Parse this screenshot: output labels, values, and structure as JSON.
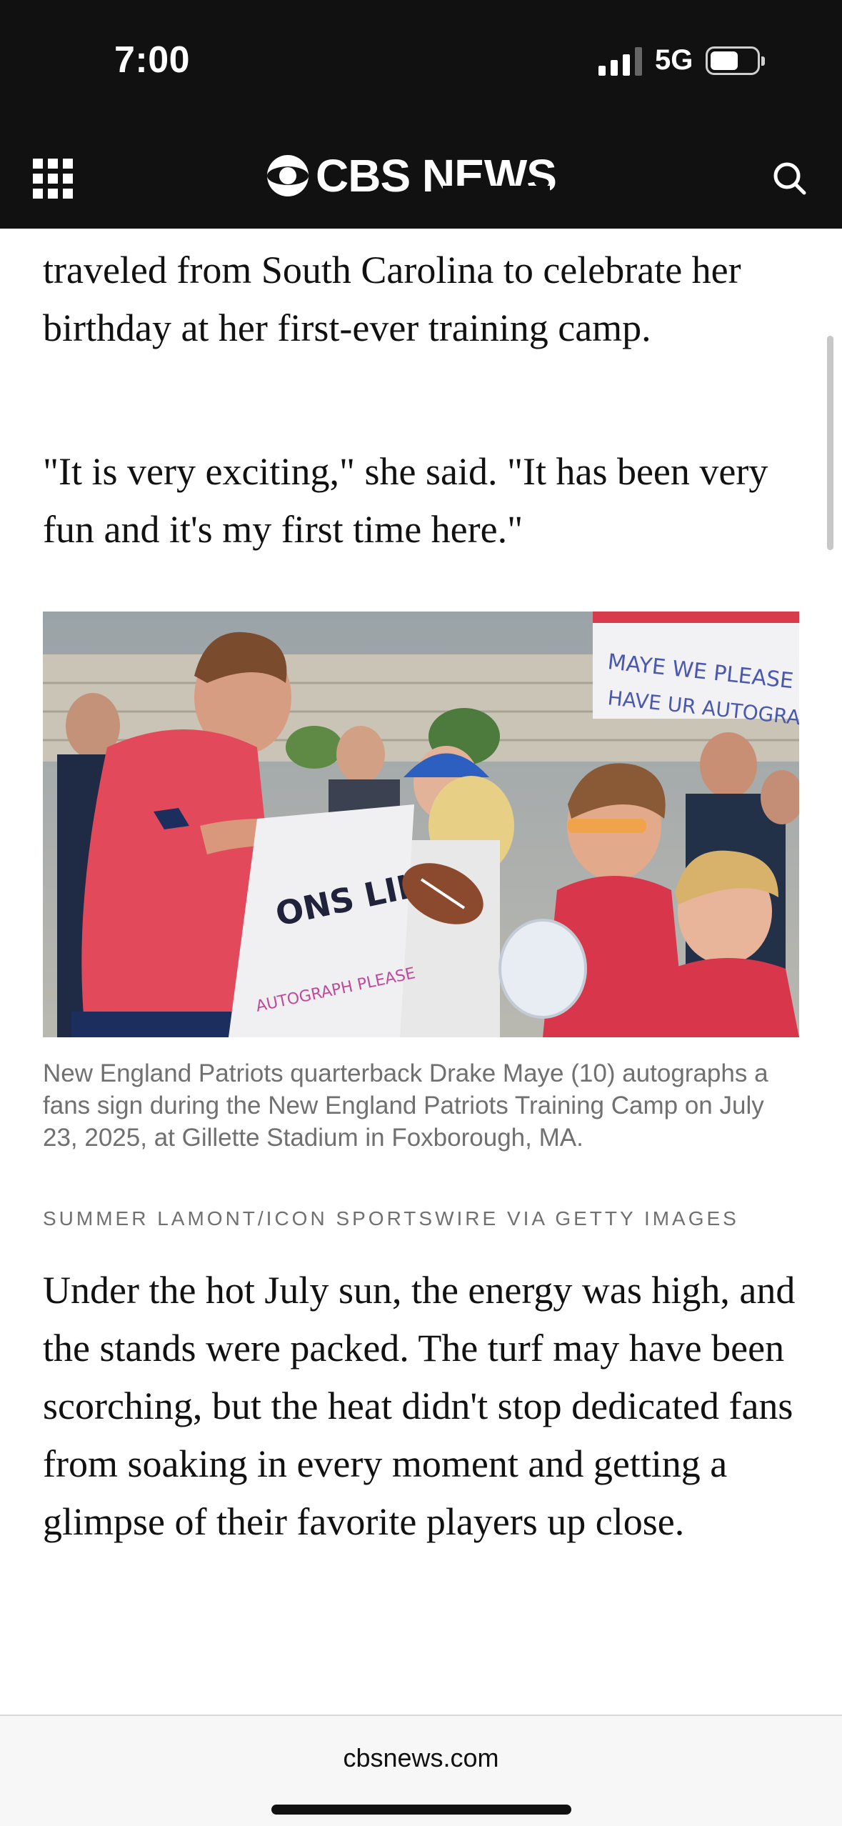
{
  "status_bar": {
    "time": "7:00",
    "network": "5G",
    "icons": [
      "signal-bars-icon",
      "battery-icon"
    ]
  },
  "header": {
    "logo_text": "CBS NEWS",
    "menu_icon": "grid-menu-icon",
    "search_icon": "search-icon",
    "background": "#111111"
  },
  "article": {
    "paragraph_1": "traveled from South Carolina to celebrate her birthday at her first-ever training camp.",
    "paragraph_2": "\"It is very exciting,\" she said. \"It has been very fun and it's my first time here.\"",
    "photo": {
      "sign_text_1": "MAYE WE PLEASE HAVE UR AUTOGRAPH",
      "sign_text_2": "ONS LIKE",
      "caption": "New England Patriots quarterback Drake Maye (10) autographs a fans sign during the New England Patriots Training Camp on July 23, 2025, at Gillette Stadium in Foxborough, MA.",
      "credit": "SUMMER LAMONT/ICON SPORTSWIRE VIA GETTY IMAGES"
    },
    "paragraph_3": "Under the hot July sun, the energy was high, and the stands were packed. The turf may have been scorching, but the heat didn't stop dedicated fans from soaking in every moment and getting a glimpse of their favorite players up close."
  },
  "browser": {
    "url": "cbsnews.com"
  }
}
